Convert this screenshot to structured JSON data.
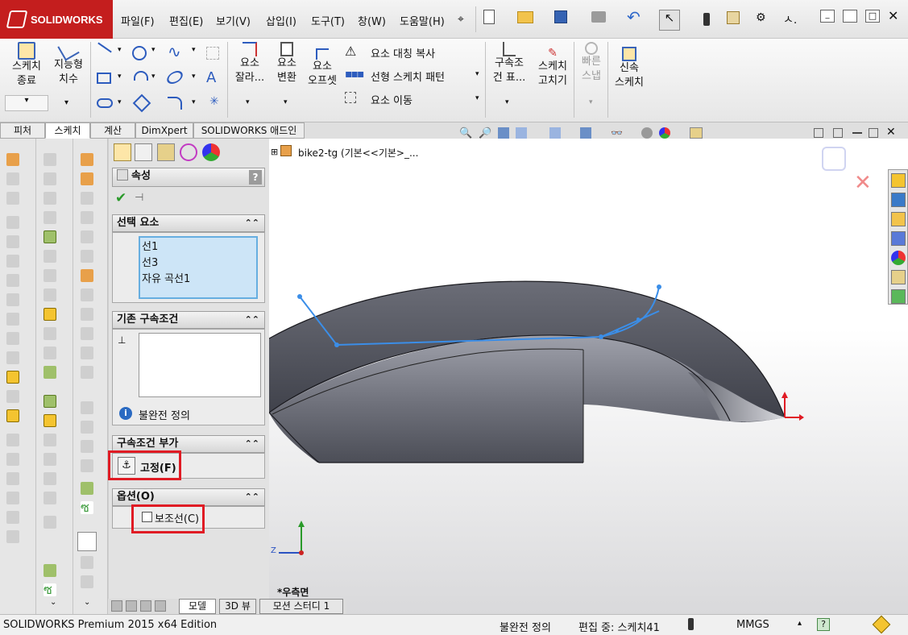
{
  "app": {
    "brand": "SOLIDWORKS"
  },
  "menu": [
    "파일(F)",
    "편집(E)",
    "보기(V)",
    "삽입(I)",
    "도구(T)",
    "창(W)",
    "도움말(H)"
  ],
  "command_manager": {
    "sketch_exit": [
      "스케치",
      "종료"
    ],
    "smart_dimension": [
      "지능형",
      "치수"
    ],
    "trim": [
      "요소",
      "잘라..."
    ],
    "convert": [
      "요소",
      "변환"
    ],
    "offset": [
      "요소",
      "오프셋"
    ],
    "mirror": "요소 대칭 복사",
    "linear_pattern": "선형 스케치 패턴",
    "move": "요소 이동",
    "relations": [
      "구속조",
      "건 표..."
    ],
    "repair": [
      "스케치",
      "고치기"
    ],
    "quick_snap": [
      "빠른",
      "스냅"
    ],
    "rapid_sketch": [
      "신속",
      "스케치"
    ]
  },
  "tabs": [
    "피처",
    "스케치",
    "계산",
    "DimXpert",
    "SOLIDWORKS 애드인"
  ],
  "active_tab": "스케치",
  "property_manager": {
    "title": "속성",
    "help": "?",
    "selected_entities": {
      "header": "선택 요소",
      "items": [
        "선1",
        "선3",
        "자유 곡선1"
      ]
    },
    "existing_relations": {
      "header": "기존 구속조건",
      "status": "불완전 정의"
    },
    "add_relations": {
      "header": "구속조건 부가",
      "fix_label": "고정(F)"
    },
    "options": {
      "header": "옵션(O)",
      "construction_label": "보조선(C)",
      "construction_checked": false
    }
  },
  "viewport": {
    "tree_root": "bike2-tg  (기본<<기본>_...",
    "view_name": "*우측면",
    "triad_z": "Z"
  },
  "bottom_tabs": [
    "모델",
    "3D 뷰",
    "모션 스터디 1"
  ],
  "status": {
    "edition": "SOLIDWORKS Premium 2015 x64 Edition",
    "definition": "불완전 정의",
    "editing": "편집 중: 스케치41",
    "units": "MMGS",
    "help": "?"
  },
  "colors": {
    "brand_red": "#c41e1e",
    "highlight_red": "#e01b24",
    "sketch_blue": "#3b8ee8",
    "selection_fill": "#cde5f7",
    "model_dark": "#4a4c55",
    "model_light": "#c8c9d0"
  }
}
